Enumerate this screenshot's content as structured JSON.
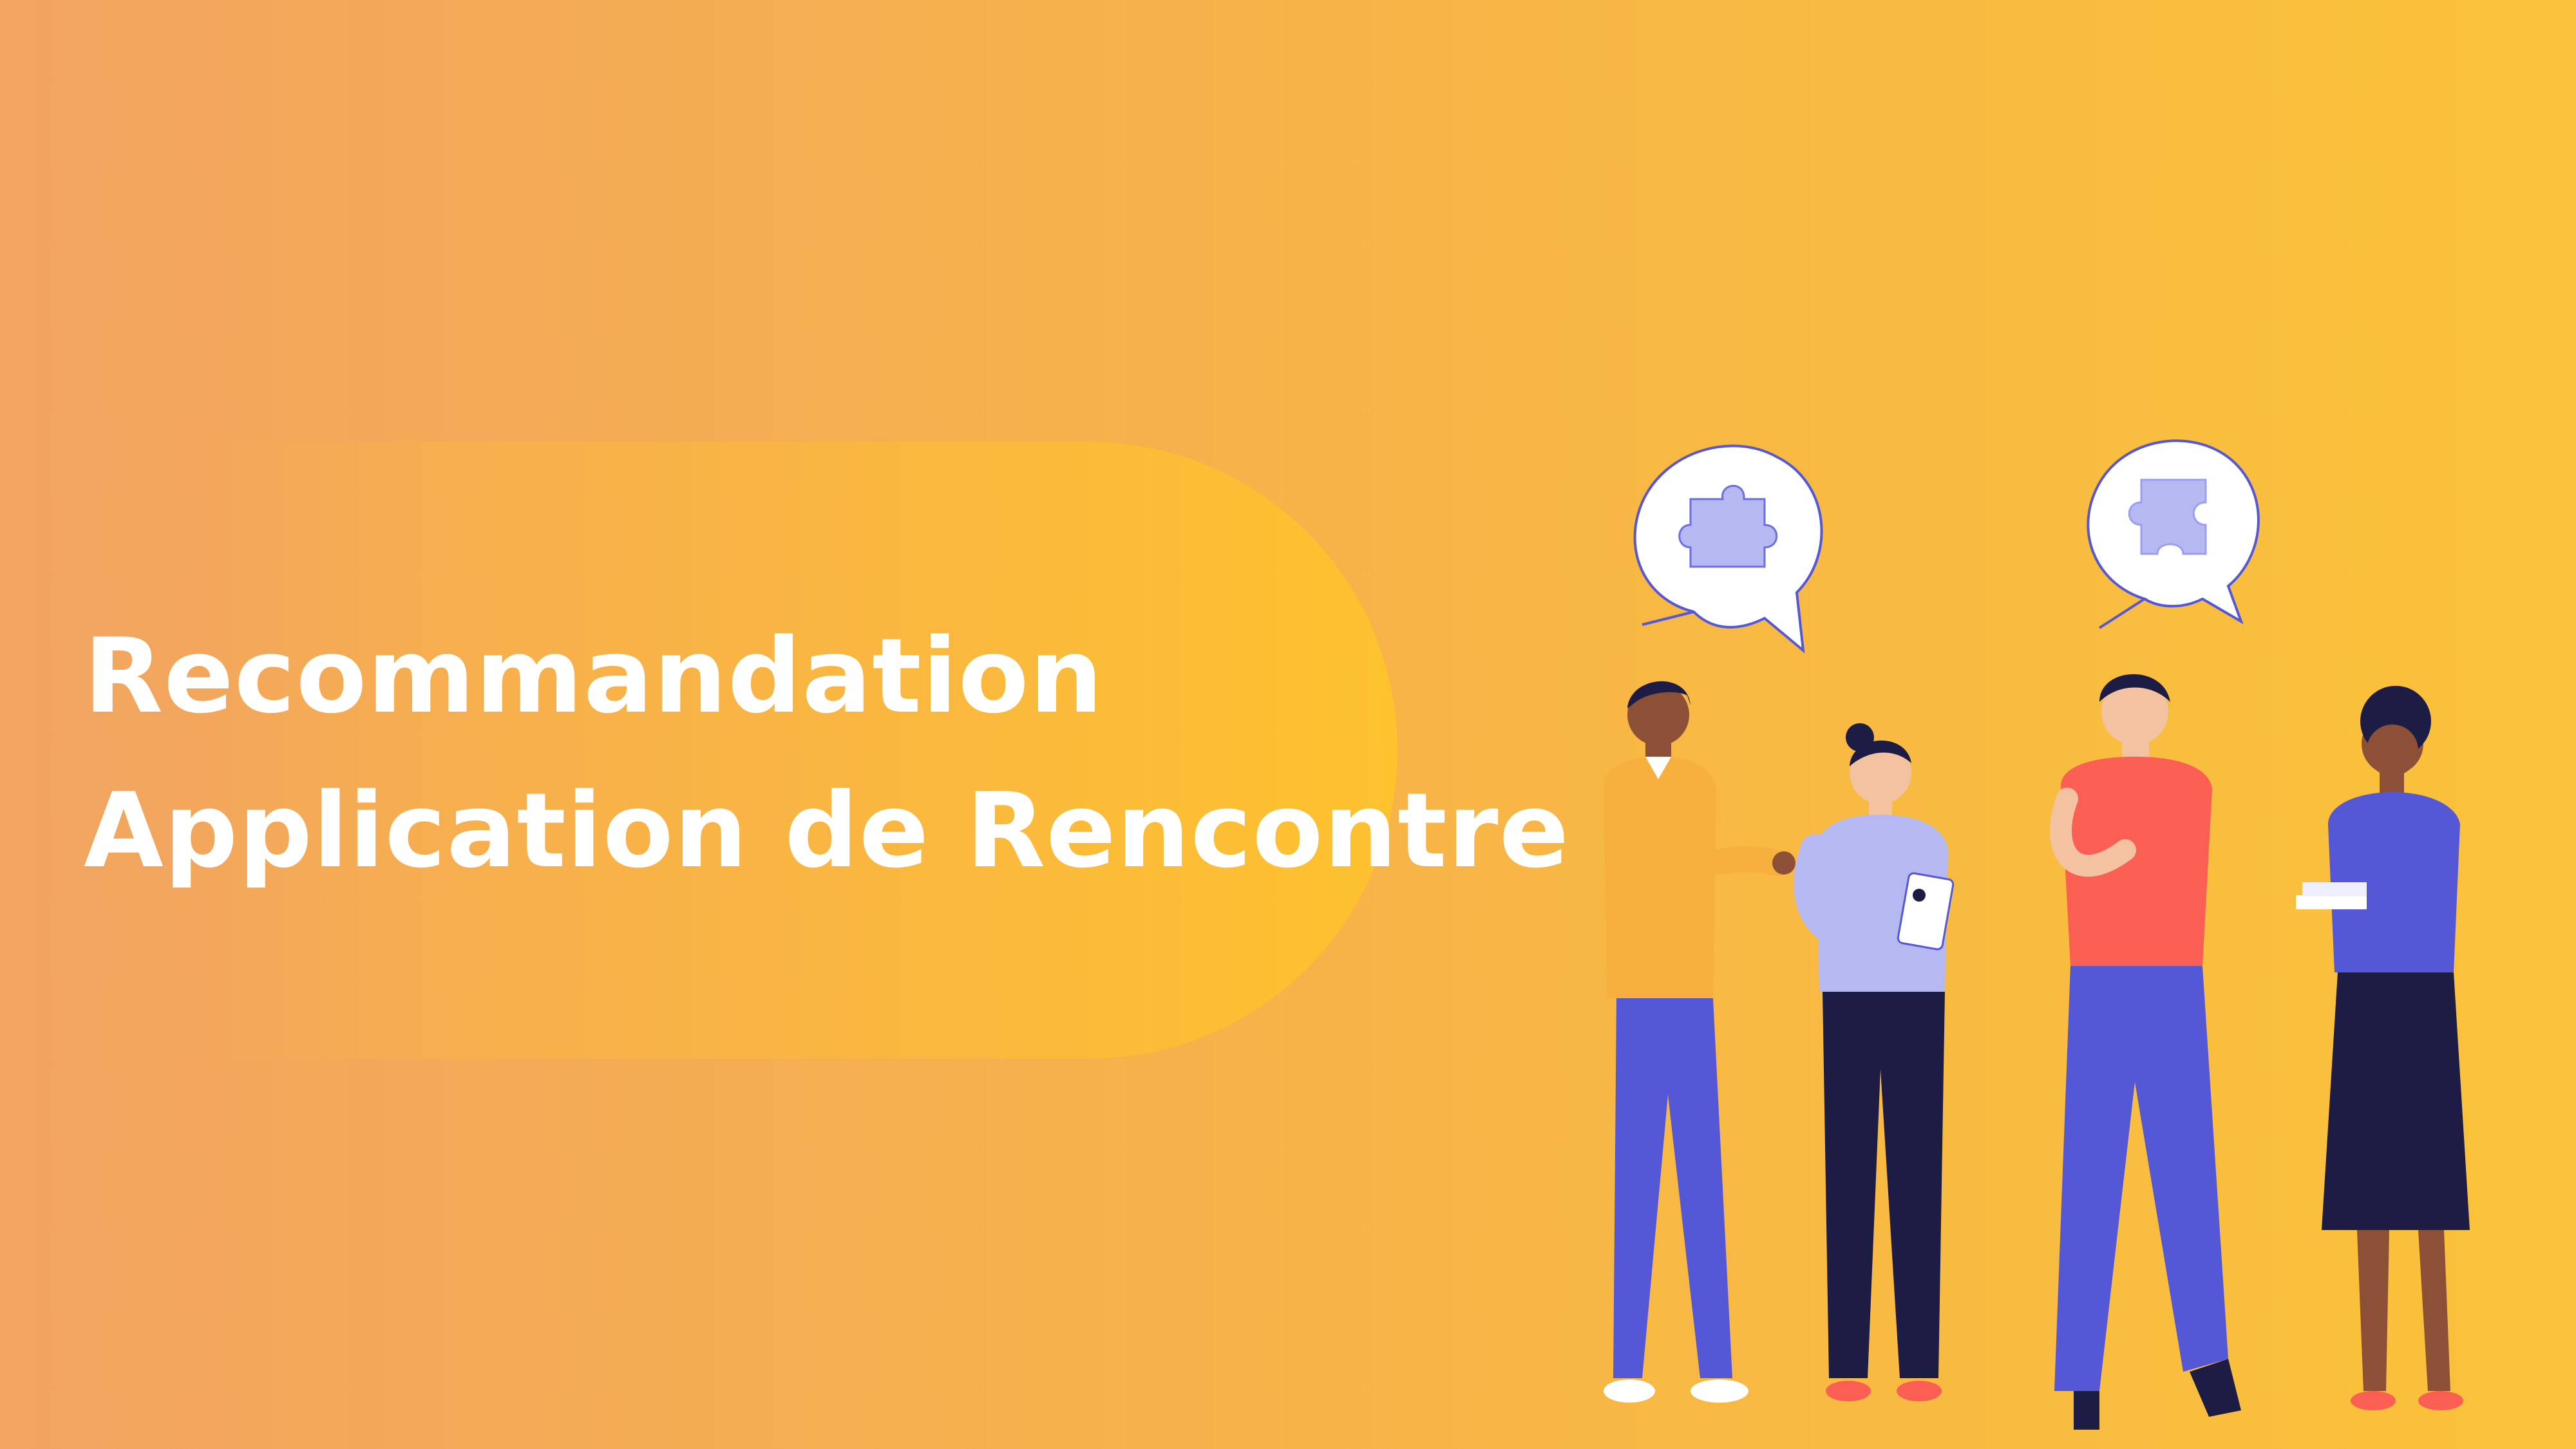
{
  "title": {
    "line1": "Recommandation",
    "line2": "Application de Rencontre"
  },
  "colors": {
    "background_left": "#f2a460",
    "background_right": "#fac23a",
    "pill": "#fdc22e",
    "text": "#ffffff",
    "accent_blue": "#5457d6",
    "lavender": "#b6b8f2",
    "navy": "#1c1c45",
    "coral": "#fb5e52",
    "mustard": "#f7b03e"
  },
  "illustration": {
    "speech_bubble_1_icon": "puzzle-piece-icon",
    "speech_bubble_2_icon": "puzzle-piece-icon"
  }
}
